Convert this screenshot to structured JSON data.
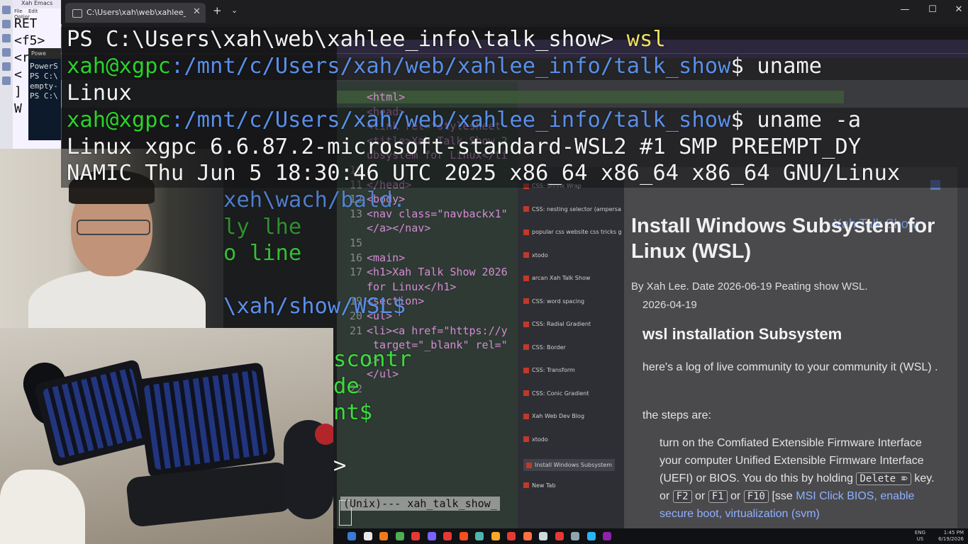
{
  "emacs": {
    "window_title": "Xah Emacs",
    "menu": [
      "File",
      "Edit",
      "Optior"
    ],
    "lines": [
      "RET",
      "<f5>",
      "<r",
      "<",
      "]",
      "W"
    ]
  },
  "powershell_mini": {
    "tab_label": "Powe",
    "lines": [
      "PowerS",
      "PS C:\\",
      "empty-",
      "PS C:\\"
    ]
  },
  "terminal": {
    "tab_title": "C:\\Users\\xah\\web\\xahlee_inf",
    "close_glyph": "✕",
    "new_tab_glyph": "+",
    "dropdown_glyph": "⌄",
    "window_buttons": {
      "minimize": "—",
      "maximize": "☐",
      "close": "✕"
    },
    "lines": [
      {
        "prompt": "PS C:\\Users\\xah\\web\\xahlee_info\\talk_show> ",
        "cmd": "wsl"
      },
      {
        "user": "xah@xgpc",
        "path": ":/mnt/c/Users/xah/web/xahlee_info/talk_show",
        "cmd": "$ uname"
      },
      {
        "text": "Linux"
      },
      {
        "user": "xah@xgpc",
        "path": ":/mnt/c/Users/xah/web/xahlee_info/talk_show",
        "cmd": "$ uname -a"
      },
      {
        "text": "Linux xgpc 6.6.87.2-microsoft-standard-WSL2 #1 SMP PREEMPT_DY"
      },
      {
        "text": "NAMIC Thu Jun 5 18:30:46 UTC 2025 x86_64 x86_64 x86_64 GNU/Linux"
      }
    ],
    "ghost_lines": [
      "xeh\\wach/bald.",
      "ly lhe",
      "o line",
      "\\xah/show/WSL$",
      "scontr",
      "de",
      "nt$",
      ">"
    ],
    "modeline": "(Unix)--- xah_talk_show_"
  },
  "editor": {
    "code": [
      {
        "num": "",
        "text": "<html>"
      },
      {
        "num": "",
        "text": "<head>"
      },
      {
        "num": "",
        "text": "<link rel=\"stylesheet"
      },
      {
        "num": "",
        "text": "<title>Xah Talk Show 2"
      },
      {
        "num": "",
        "text": "ubsystem for Linux</ti"
      },
      {
        "num": "10",
        "text": ""
      },
      {
        "num": "11",
        "text": "</head>"
      },
      {
        "num": "12",
        "text": "<body>"
      },
      {
        "num": "13",
        "text": "<nav class=\"navbackx1\""
      },
      {
        "num": "",
        "text": "</a></nav>"
      },
      {
        "num": "15",
        "text": ""
      },
      {
        "num": "16",
        "text": "<main>"
      },
      {
        "num": "17",
        "text": "<h1>Xah Talk Show 2026"
      },
      {
        "num": "",
        "text": "for Linux</h1>"
      },
      {
        "num": "19",
        "text": "<section>"
      },
      {
        "num": "20",
        "text": "<ul>"
      },
      {
        "num": "21",
        "text": "<li><a href=\"https://y"
      },
      {
        "num": "",
        "text": " target=\"_blank\" rel=\""
      },
      {
        "num": "",
        "text": "i>"
      },
      {
        "num": "",
        "text": "</ul>"
      },
      {
        "num": "22",
        "text": ""
      }
    ]
  },
  "browser": {
    "tabs": [
      "CSS: Shrink Wrap",
      "CSS: nesting selector (ampersa",
      "popular css website css tricks g",
      "xtodo",
      "arcan Xah Talk Show",
      "CSS: word spacing",
      "CSS: Radial Gradient",
      "CSS: Border",
      "CSS: Transform",
      "CSS: Conic Gradient",
      "Xah Web Dev Blog",
      "xtodo",
      "Install Windows Subsystem",
      "New Tab"
    ],
    "active_tab_index": 12,
    "site_title": "Xah Talk Show",
    "h1": "Install Windows Subsystem for Linux (WSL)",
    "byline": "By Xah Lee. Date 2026-06-19 Peating show WSL.",
    "date2": "2026-04-19",
    "h2": "wsl installation Subsystem",
    "p1": "here's a log of live community to your community it (WSL) .",
    "p2": "the steps are:",
    "li1_a": "turn on the Comfiated Extensible Firmware Interface your computer Unified Extensible Firmware Interface (UEFI) or BIOS. You do this by holding",
    "key_delete": "Delete ⌦",
    "li1_b": "key. or",
    "key_f2": "F2",
    "or1": "or",
    "key_f1": "F1",
    "or2": "or",
    "key_f10": "F10",
    "see": "[sse",
    "link1": "MSI Click BIOS,",
    "link2": "enable secure boot, virtualization (svm)"
  },
  "taskbar": {
    "lang": [
      "ENG",
      "US"
    ],
    "clock": [
      "1:45 PM",
      "6/19/2026"
    ]
  }
}
